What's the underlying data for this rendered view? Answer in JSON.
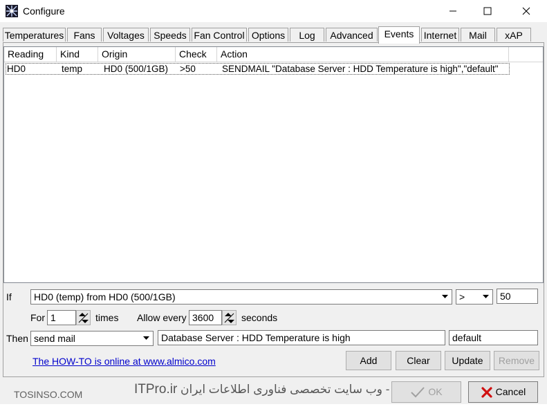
{
  "window": {
    "title": "Configure"
  },
  "tabs": [
    {
      "label": "Temperatures",
      "active": false
    },
    {
      "label": "Fans",
      "active": false
    },
    {
      "label": "Voltages",
      "active": false
    },
    {
      "label": "Speeds",
      "active": false
    },
    {
      "label": "Fan Control",
      "active": false
    },
    {
      "label": "Options",
      "active": false
    },
    {
      "label": "Log",
      "active": false
    },
    {
      "label": "Advanced",
      "active": false
    },
    {
      "label": "Events",
      "active": true
    },
    {
      "label": "Internet",
      "active": false
    },
    {
      "label": "Mail",
      "active": false
    },
    {
      "label": "xAP",
      "active": false
    }
  ],
  "events_list": {
    "columns": [
      "Reading",
      "Kind",
      "Origin",
      "Check",
      "Action"
    ],
    "rows": [
      {
        "reading": "HD0",
        "kind": "temp",
        "origin": "HD0 (500/1GB)",
        "check": ">50",
        "action": "SENDMAIL \"Database Server : HDD Temperature is high\",\"default\""
      }
    ]
  },
  "condition": {
    "if_label": "If",
    "source_value": "HD0 (temp) from HD0 (500/1GB)",
    "operator_value": ">",
    "threshold_value": "50",
    "for_label": "For",
    "times_value": "1",
    "times_label": "times",
    "allow_label": "Allow every",
    "interval_value": "3600",
    "seconds_label": "seconds",
    "then_label": "Then",
    "action_value": "send mail",
    "message_value": "Database Server : HDD Temperature is high",
    "profile_value": "default"
  },
  "buttons": {
    "add": "Add",
    "clear": "Clear",
    "update": "Update",
    "remove": "Remove",
    "ok": "OK",
    "cancel": "Cancel"
  },
  "howto_link": "The HOW-TO is online at www.almico.com",
  "footer": {
    "watermark_left": "TOSINSO.COM",
    "watermark_brand": "ITPro.ir",
    "watermark_fa": "- وب سایت تخصصی فناوری اطلاعات ایران"
  },
  "colors": {
    "cancel_x": "#d01010",
    "link": "#0000cc"
  },
  "icons": [
    "app-icon",
    "minimize-icon",
    "maximize-icon",
    "close-icon",
    "chevron-down-icon",
    "spin-up-down-icon",
    "check-icon",
    "x-icon"
  ]
}
